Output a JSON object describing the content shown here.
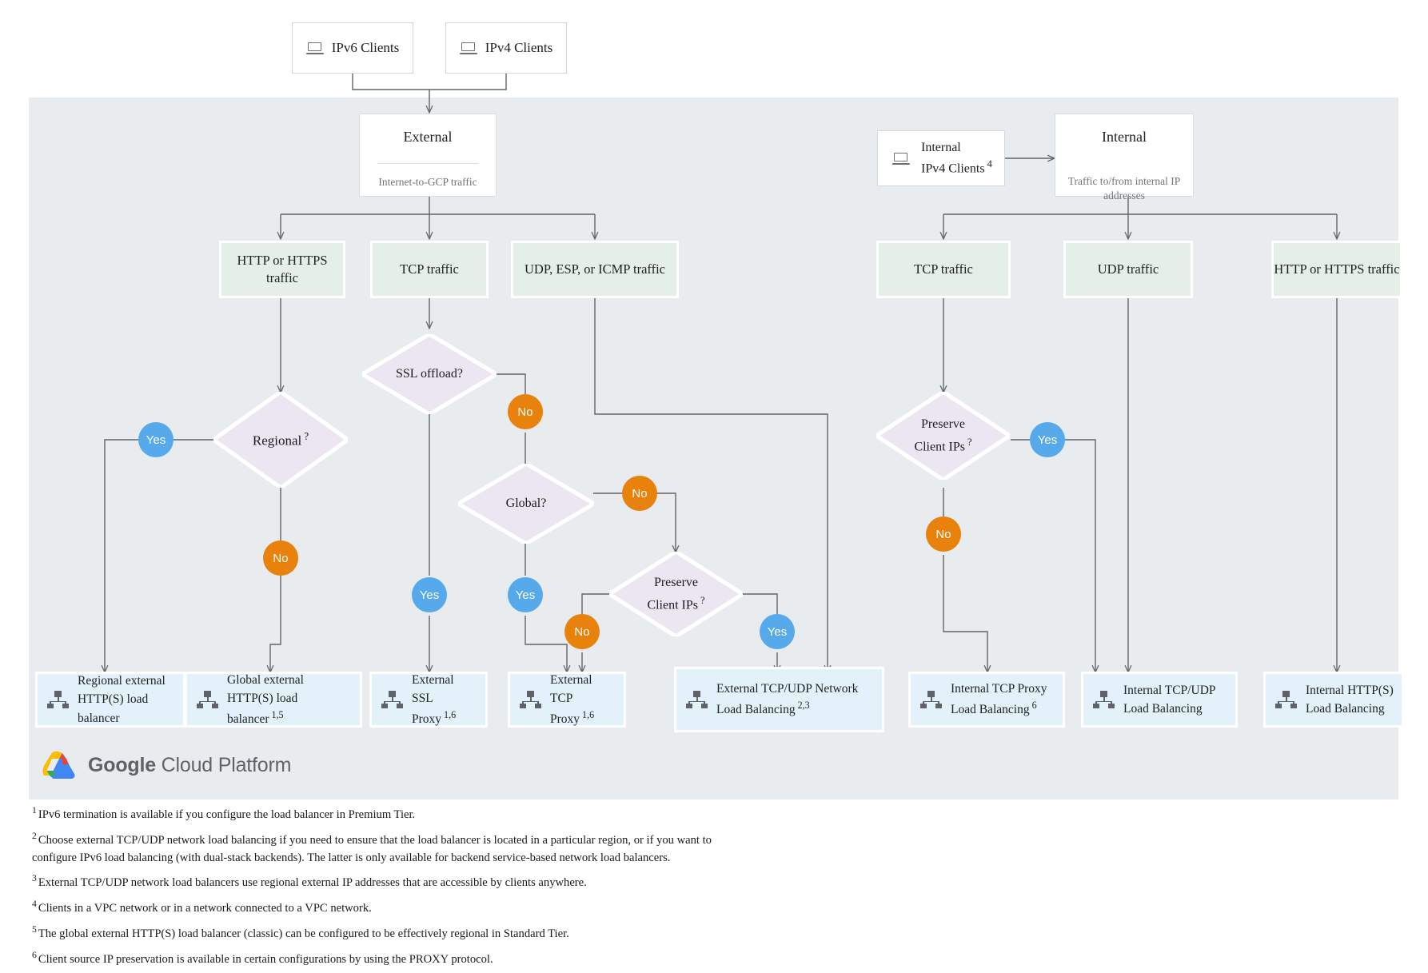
{
  "clients": [
    {
      "id": "ipv6-clients",
      "label": "IPv6 Clients"
    },
    {
      "id": "ipv4-clients",
      "label": "IPv4 Clients"
    }
  ],
  "internal_client": {
    "line1": "Internal",
    "line2": "IPv4 Clients",
    "note": "4"
  },
  "scopes": [
    {
      "id": "external",
      "title": "External",
      "subtitle": "Internet-to-GCP traffic"
    },
    {
      "id": "internal",
      "title": "Internal",
      "subtitle": "Traffic to/from internal IP addresses"
    }
  ],
  "traffic": [
    {
      "id": "ext-http",
      "label": "HTTP or HTTPS traffic"
    },
    {
      "id": "ext-tcp",
      "label": "TCP traffic"
    },
    {
      "id": "ext-udp",
      "label": "UDP, ESP, or ICMP traffic"
    },
    {
      "id": "int-tcp",
      "label": "TCP traffic"
    },
    {
      "id": "int-udp",
      "label": "UDP traffic"
    },
    {
      "id": "int-http",
      "label": "HTTP or HTTPS traffic"
    }
  ],
  "decisions": [
    {
      "id": "regional",
      "label": "Regional",
      "suffix": "?"
    },
    {
      "id": "ssl-offload",
      "label": "SSL offload?",
      "suffix": ""
    },
    {
      "id": "global",
      "label": "Global?",
      "suffix": ""
    },
    {
      "id": "preserve-ext",
      "label": "Preserve\nClient IPs",
      "suffix": "?"
    },
    {
      "id": "preserve-int",
      "label": "Preserve\nClient IPs",
      "suffix": "?"
    }
  ],
  "badges": [
    {
      "id": "regional-yes",
      "label": "Yes",
      "kind": "yes"
    },
    {
      "id": "regional-no",
      "label": "No",
      "kind": "no"
    },
    {
      "id": "ssl-no",
      "label": "No",
      "kind": "no"
    },
    {
      "id": "ssl-yes",
      "label": "Yes",
      "kind": "yes"
    },
    {
      "id": "global-no",
      "label": "No",
      "kind": "no"
    },
    {
      "id": "global-yes",
      "label": "Yes",
      "kind": "yes"
    },
    {
      "id": "preserve-ext-no",
      "label": "No",
      "kind": "no"
    },
    {
      "id": "preserve-ext-yes",
      "label": "Yes",
      "kind": "yes"
    },
    {
      "id": "preserve-int-yes",
      "label": "Yes",
      "kind": "yes"
    },
    {
      "id": "preserve-int-no",
      "label": "No",
      "kind": "no"
    }
  ],
  "results": [
    {
      "id": "regional-external-https",
      "label": "Regional external HTTP(S) load balancer",
      "note": ""
    },
    {
      "id": "global-external-https",
      "label": "Global external HTTP(S) load balancer",
      "note": "1,5"
    },
    {
      "id": "external-ssl-proxy",
      "label": "External SSL Proxy",
      "note": "1,6"
    },
    {
      "id": "external-tcp-proxy",
      "label": "External TCP Proxy",
      "note": "1,6"
    },
    {
      "id": "external-tcp-udp-nlb",
      "label": "External TCP/UDP Network Load Balancing",
      "note": "2,3"
    },
    {
      "id": "internal-tcp-proxy",
      "label": "Internal TCP Proxy Load Balancing",
      "note": "6"
    },
    {
      "id": "internal-tcp-udp-lb",
      "label": "Internal TCP/UDP Load Balancing",
      "note": ""
    },
    {
      "id": "internal-https-lb",
      "label": "Internal HTTP(S) Load Balancing",
      "note": ""
    }
  ],
  "logo": {
    "brand": "Google",
    "product": "Cloud Platform",
    "icon": "google-cloud-icon"
  },
  "footnotes": [
    {
      "n": "1",
      "text": "IPv6 termination is available if you configure the load balancer in Premium Tier."
    },
    {
      "n": "2",
      "text": "Choose external TCP/UDP network load balancing if you need to ensure that the load balancer is located in a particular region, or if you want to configure IPv6 load balancing (with dual-stack backends). The latter is only available for backend service-based network load balancers."
    },
    {
      "n": "3",
      "text": "External TCP/UDP network load balancers use regional external IP addresses that are accessible by clients anywhere."
    },
    {
      "n": "4",
      "text": "Clients in a VPC network or in a network connected to a VPC network."
    },
    {
      "n": "5",
      "text": "The global external HTTP(S) load balancer (classic) can be configured to be effectively regional in Standard Tier."
    },
    {
      "n": "6",
      "text": "Client source IP preservation is available in certain configurations by using the PROXY protocol."
    }
  ],
  "colors": {
    "panel_bg": "#e9ecee",
    "traffic_bg": "#e3efe7",
    "decision_bg": "#ece6f3",
    "result_bg": "#e2f1fa",
    "yes": "#56aaec",
    "no": "#e8820c",
    "edge": "#616568"
  }
}
